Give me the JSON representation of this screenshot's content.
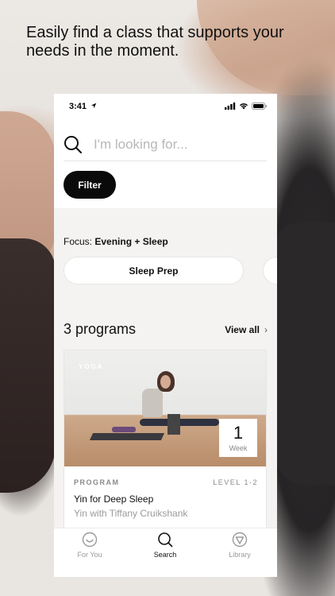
{
  "headline": "Easily find a class that supports your needs in the moment.",
  "status_bar": {
    "time": "3:41"
  },
  "search": {
    "placeholder": "I'm looking for..."
  },
  "filter_label": "Filter",
  "focus": {
    "prefix": "Focus:",
    "value": "Evening + Sleep"
  },
  "chips": [
    "Sleep Prep"
  ],
  "programs": {
    "title": "3 programs",
    "view_all": "View all"
  },
  "card": {
    "tag": "YOGA",
    "week_number": "1",
    "week_label": "Week",
    "type": "PROGRAM",
    "level": "LEVEL 1-2",
    "title": "Yin for Deep Sleep",
    "subtitle": "Yin with Tiffany Cruikshank"
  },
  "tabs": [
    {
      "label": "For You",
      "icon": "smile-icon",
      "active": false
    },
    {
      "label": "Search",
      "icon": "search-icon",
      "active": true
    },
    {
      "label": "Library",
      "icon": "library-icon",
      "active": false
    }
  ]
}
